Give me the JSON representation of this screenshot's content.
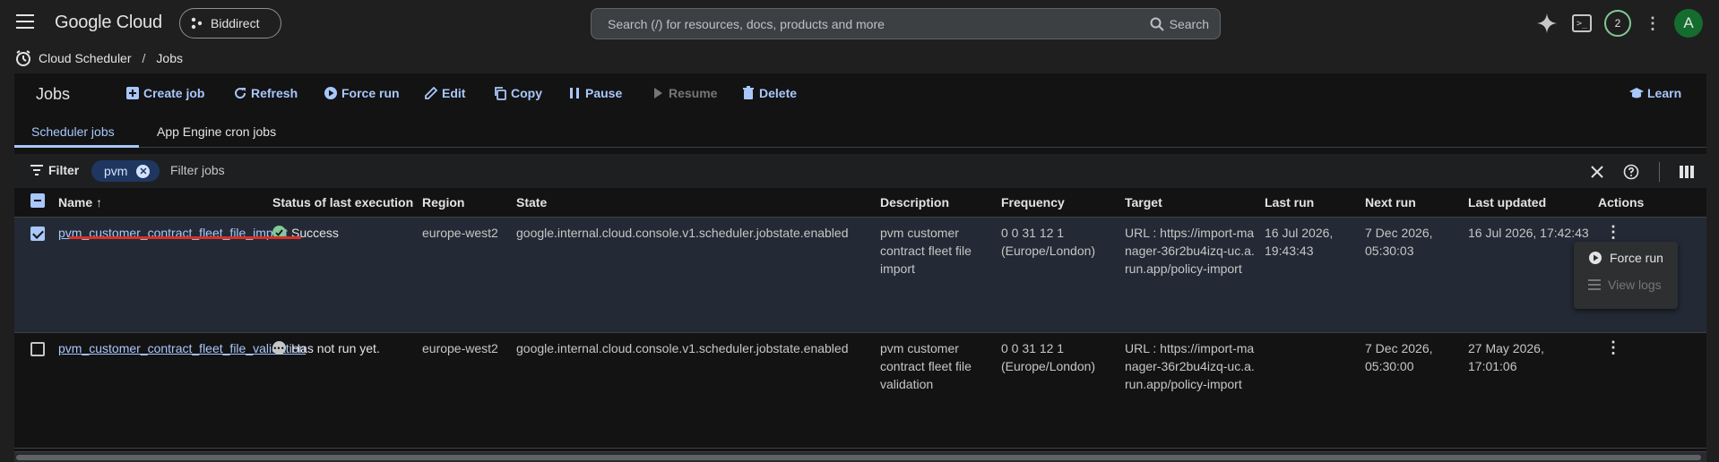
{
  "topbar": {
    "brand": "Google Cloud",
    "project": "Biddirect",
    "search_placeholder": "Search (/) for resources, docs, products and more",
    "search_button": "Search",
    "notifications_count": "2",
    "avatar_letter": "A"
  },
  "breadcrumb": {
    "service": "Cloud Scheduler",
    "separator": "/",
    "page": "Jobs"
  },
  "toolbar": {
    "title": "Jobs",
    "create": "Create job",
    "refresh": "Refresh",
    "force_run": "Force run",
    "edit": "Edit",
    "copy": "Copy",
    "pause": "Pause",
    "resume": "Resume",
    "delete": "Delete",
    "learn": "Learn"
  },
  "tabs": [
    "Scheduler jobs",
    "App Engine cron jobs"
  ],
  "filter": {
    "label": "Filter",
    "chip": "pvm",
    "placeholder": "Filter jobs"
  },
  "table": {
    "columns": [
      "Name",
      "Status of last execution",
      "Region",
      "State",
      "Description",
      "Frequency",
      "Target",
      "Last run",
      "Next run",
      "Last updated",
      "Actions"
    ],
    "rows": [
      {
        "name": "pvm_customer_contract_fleet_file_import",
        "status": "Success",
        "region": "europe-west2",
        "state": "google.internal.cloud.console.v1.scheduler.jobstate.enabled",
        "description": "pvm customer contract fleet file import",
        "frequency": "0 0 31 12 1 (Europe/London)",
        "target": "URL : https://import-manager-36r2bu4izq-uc.a.run.app/policy-import",
        "last_run": "16 Jul 2026, 19:43:43",
        "next_run": "7 Dec 2026, 05:30:03",
        "last_updated": "16 Jul 2026, 17:42:43",
        "selected": true
      },
      {
        "name": "pvm_customer_contract_fleet_file_validation",
        "status": "Has not run yet.",
        "region": "europe-west2",
        "state": "google.internal.cloud.console.v1.scheduler.jobstate.enabled",
        "description": "pvm customer contract fleet file validation",
        "frequency": "0 0 31 12 1 (Europe/London)",
        "target": "URL : https://import-manager-36r2bu4izq-uc.a.run.app/policy-import",
        "last_run": "",
        "next_run": "7 Dec 2026, 05:30:00",
        "last_updated": "27 May 2026, 17:01:06",
        "selected": false
      }
    ]
  },
  "row_menu": {
    "force_run": "Force run",
    "view_logs": "View logs"
  },
  "colors": {
    "accent": "#a8c7fa",
    "success": "#81c995",
    "annotation_red": "#d93025"
  }
}
